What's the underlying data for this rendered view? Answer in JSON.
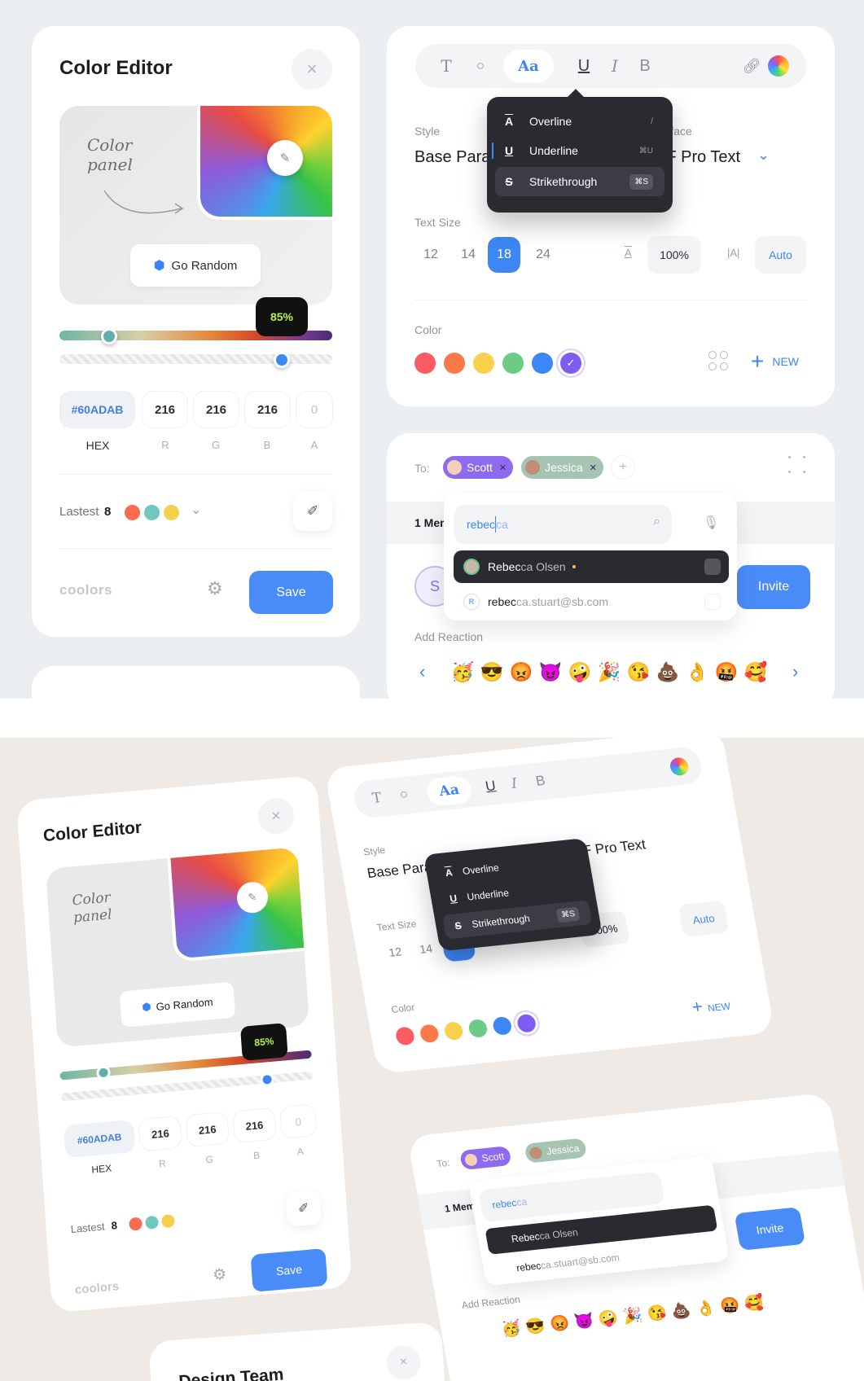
{
  "colors": {
    "accent": "#4a8cf7",
    "dark": "#2a2b31",
    "bg_top": "#eceff2",
    "bg_bottom": "#efeae5"
  },
  "color_editor": {
    "title": "Color Editor",
    "close_icon": "close-icon",
    "panel_note": "Color\npanel",
    "go_random": "Go Random",
    "tooltip": "85%",
    "hue_position": 0.23,
    "opacity_value": 0.85,
    "hex": "#60ADAB",
    "r": "216",
    "g": "216",
    "b": "216",
    "a": "0",
    "hex_label": "HEX",
    "r_label": "R",
    "g_label": "G",
    "b_label": "B",
    "a_label": "A",
    "latest_label": "Lastest",
    "latest_count": "8",
    "latest_colors": [
      "#fb6b4f",
      "#6fc7c0",
      "#f5cf4e"
    ],
    "brand": "coolors",
    "save": "Save"
  },
  "text_panel": {
    "toolbar": [
      "T",
      "◊",
      "Aa",
      "U",
      "I",
      "B"
    ],
    "dropdown": [
      {
        "icon": "A",
        "label": "Overline",
        "key": "/"
      },
      {
        "icon": "U",
        "label": "Underline",
        "key": "⌘U"
      },
      {
        "icon": "S",
        "label": "Strikethrough",
        "key": "⌘S"
      }
    ],
    "style_label": "Style",
    "style_value": "Base Parag",
    "typeface_label": "Typeface",
    "typeface_value": "SF Pro Text",
    "text_size_label": "Text Size",
    "sizes": [
      "12",
      "14",
      "18",
      "24"
    ],
    "line_height": "100%",
    "letter_spacing": "Auto",
    "color_label": "Color",
    "swatches": [
      "#fb5b63",
      "#fc7a4a",
      "#fbd04f",
      "#6ccb87",
      "#3d86f6",
      "#7c5cf2"
    ],
    "new_label": "NEW"
  },
  "invite_panel": {
    "to_label": "To:",
    "recipients": [
      "Scott",
      "Jessica"
    ],
    "members_label": "1 Mem",
    "search_typed": "rebec",
    "search_rest": "ca",
    "results": [
      {
        "match": "Rebec",
        "rest": "ca Olsen"
      },
      {
        "match": "rebec",
        "rest": "ca.stuart@sb.com"
      }
    ],
    "invite": "Invite",
    "reaction_label": "Add Reaction",
    "emojis": [
      "🥳",
      "😎",
      "😡",
      "😈",
      "🤪",
      "🎉",
      "😘",
      "💩",
      "👌",
      "🤬",
      "🥰"
    ]
  },
  "design_team": {
    "title": "Design Team"
  }
}
